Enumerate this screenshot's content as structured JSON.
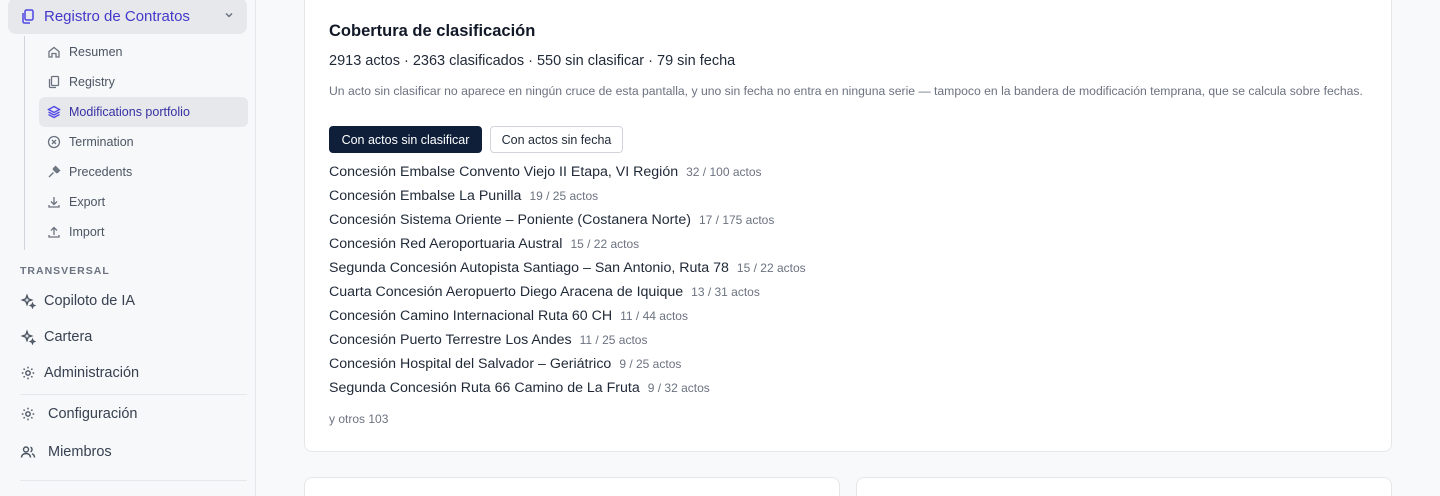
{
  "sidebar": {
    "parent": {
      "label": "Registro de Contratos",
      "icon": "contracts-icon"
    },
    "subitems": [
      {
        "label": "Resumen",
        "icon": "home-icon"
      },
      {
        "label": "Registry",
        "icon": "registry-icon"
      },
      {
        "label": "Modifications portfolio",
        "icon": "layers-icon",
        "active": true
      },
      {
        "label": "Termination",
        "icon": "circle-x-icon"
      },
      {
        "label": "Precedents",
        "icon": "gavel-icon"
      },
      {
        "label": "Export",
        "icon": "download-icon"
      },
      {
        "label": "Import",
        "icon": "upload-icon"
      }
    ],
    "section_title": "TRANSVERSAL",
    "items": [
      {
        "label": "Copiloto de IA",
        "icon": "sparkles-icon"
      },
      {
        "label": "Cartera",
        "icon": "sparkles-icon"
      },
      {
        "label": "Administración",
        "icon": "gear-icon"
      }
    ],
    "bottom_items": [
      {
        "label": "Configuración",
        "icon": "gear-icon"
      },
      {
        "label": "Miembros",
        "icon": "users-icon"
      }
    ]
  },
  "main": {
    "title": "Cobertura de clasificación",
    "summary": "2913 actos · 2363 clasificados · 550 sin clasificar · 79 sin fecha",
    "note": "Un acto sin clasificar no aparece en ningún cruce de esta pantalla, y uno sin fecha no entra en ninguna serie — tampoco en la bandera de modificación temprana, que se calcula sobre fechas.",
    "filters": {
      "unclassified_label": "Con actos sin clasificar",
      "undated_label": "Con actos sin fecha"
    },
    "concessions": [
      {
        "name": "Concesión Embalse Convento Viejo II Etapa, VI Región",
        "count": "32 / 100 actos"
      },
      {
        "name": "Concesión Embalse La Punilla",
        "count": "19 / 25 actos"
      },
      {
        "name": "Concesión Sistema Oriente – Poniente (Costanera Norte)",
        "count": "17 / 175 actos"
      },
      {
        "name": "Concesión Red Aeroportuaria Austral",
        "count": "15 / 22 actos"
      },
      {
        "name": "Segunda Concesión Autopista Santiago – San Antonio, Ruta 78",
        "count": "15 / 22 actos"
      },
      {
        "name": "Cuarta Concesión Aeropuerto Diego Aracena de Iquique",
        "count": "13 / 31 actos"
      },
      {
        "name": "Concesión Camino Internacional Ruta 60 CH",
        "count": "11 / 44 actos"
      },
      {
        "name": "Concesión Puerto Terrestre Los Andes",
        "count": "11 / 25 actos"
      },
      {
        "name": "Concesión Hospital del Salvador – Geriátrico",
        "count": "9 / 25 actos"
      },
      {
        "name": "Segunda Concesión Ruta 66 Camino de La Fruta",
        "count": "9 / 32 actos"
      }
    ],
    "more": "y otros 103"
  }
}
